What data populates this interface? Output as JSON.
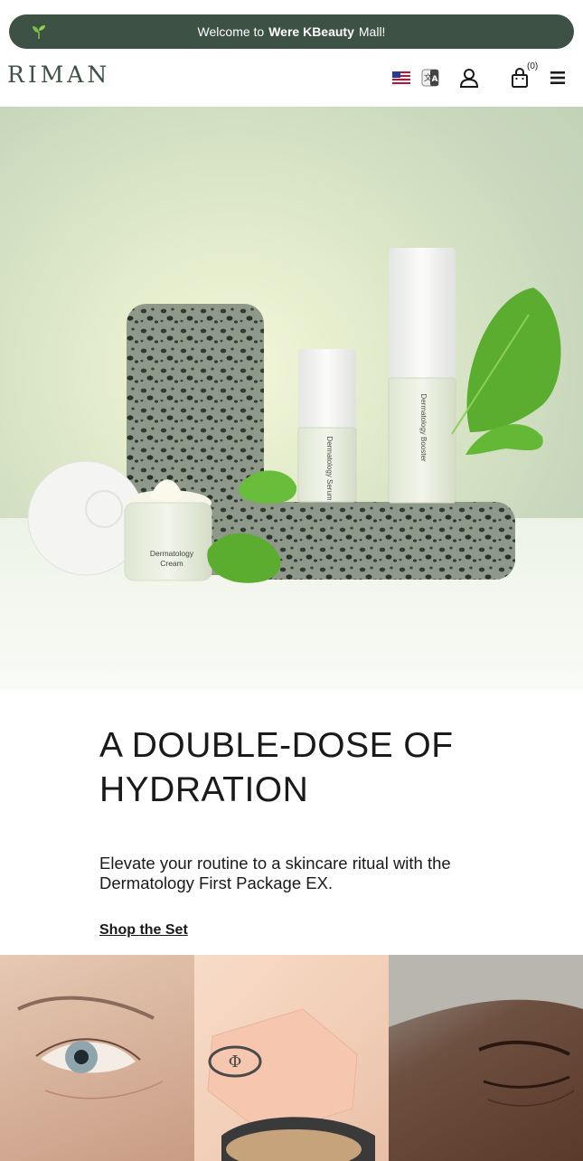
{
  "banner": {
    "prefix": "Welcome to",
    "brand": "Were KBeauty",
    "suffix": "Mall!"
  },
  "header": {
    "logo": "RIMAN",
    "cart_count": "(0)",
    "icons": [
      "us-flag-icon",
      "translate-icon",
      "user-icon",
      "shopping-bag-icon",
      "hamburger-menu-icon"
    ]
  },
  "hero": {
    "product_labels": {
      "serum": "Dermatology Serum",
      "booster": "Dermatology Booster",
      "cream_line1": "Dermatology",
      "cream_line2": "Cream"
    }
  },
  "promo": {
    "headline": "A DOUBLE-DOSE OF HYDRATION",
    "subtext": "Elevate your routine to a skincare ritual with the Dermatology First Package EX.",
    "link": "Shop the Set"
  },
  "colors": {
    "brand_green": "#3d5145",
    "text": "#1a1a1a"
  }
}
